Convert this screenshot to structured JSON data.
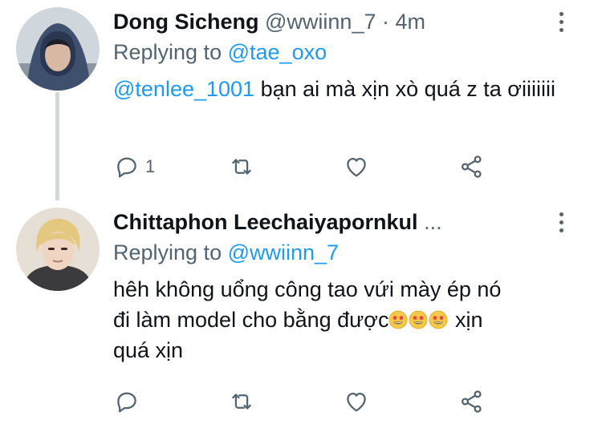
{
  "tweets": [
    {
      "name": "Dong Sicheng",
      "handle": "@wwiinn_7",
      "separator": "·",
      "time": "4m",
      "replying_prefix": "Replying to",
      "replying_to": "@tae_oxo",
      "mention": "@tenlee_1001",
      "text": " bạn ai mà xịn xò quá z ta ơiiiiiii",
      "reply_count": "1"
    },
    {
      "name": "Chittaphon Leechaiyapornkul",
      "ellipsis": "...",
      "replying_prefix": "Replying to",
      "replying_to": "@wwiinn_7",
      "text_line1": "hêh không uổng công tao vứi mày ép nó",
      "text_line2": "đi làm model cho bằng được",
      "text_line3": " xịn",
      "text_line4": "quá xịn",
      "emoji_count": 3,
      "reply_count": ""
    }
  ],
  "icons": {
    "reply": "reply-icon",
    "retweet": "retweet-icon",
    "like": "heart-icon",
    "share": "share-icon",
    "more": "more-icon",
    "emoji": "star-struck-emoji-icon"
  },
  "colors": {
    "text": "#0f1419",
    "secondary": "#536471",
    "link": "#1d9bf0",
    "thread_line": "#cfd9de"
  }
}
